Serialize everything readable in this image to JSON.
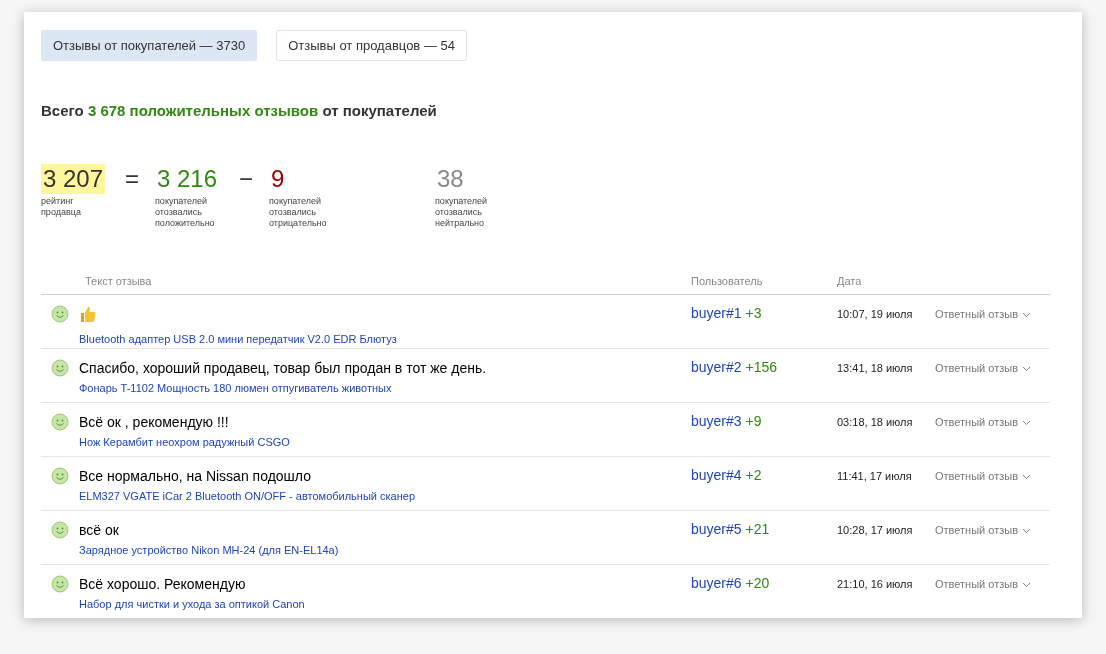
{
  "tabs": [
    {
      "label": "Отзывы от покупателей — 3730",
      "selected": true
    },
    {
      "label": "Отзывы от продавцов — 54",
      "selected": false
    }
  ],
  "summary": {
    "prefix": "Всего",
    "highlight": "3 678 положительных отзывов",
    "suffix": "от покупателей"
  },
  "stats": [
    {
      "kind": "rating",
      "value": "3 207",
      "caption": "рейтинг продавца"
    },
    {
      "kind": "operator",
      "value": "="
    },
    {
      "kind": "positive",
      "value": "3 216",
      "caption": "покупателей отозвались положительно"
    },
    {
      "kind": "operator",
      "value": "−"
    },
    {
      "kind": "negative",
      "value": "9",
      "caption": "покупателей отозвались отрицательно"
    },
    {
      "kind": "neutral",
      "value": "38",
      "caption": "покупателей отозвались нейтрально"
    }
  ],
  "table": {
    "columns": [
      "Текст отзыва",
      "Пользователь",
      "Дата"
    ],
    "rows": [
      {
        "kind": "thumbs_up",
        "product": "Bluetooth адаптер USB 2.0 мини передатчик V2.0 EDR Блютуз",
        "user": "buyer#1",
        "score": "+3",
        "date": "10:07, 19 июля",
        "reply": "Ответный отзыв"
      },
      {
        "kind": "text",
        "text": "Спасибо, хороший продавец, товар был продан в тот же день.",
        "product": "Фонарь T-1102 Мощность 180 люмен отпугиватель животных",
        "user": "buyer#2",
        "score": "+156",
        "date": "13:41, 18 июля",
        "reply": "Ответный отзыв"
      },
      {
        "kind": "text",
        "text": "Всё ок , рекомендую !!!",
        "product": "Нож Керамбит неохром радужный CSGO",
        "user": "buyer#3",
        "score": "+9",
        "date": "03:18, 18 июля",
        "reply": "Ответный отзыв"
      },
      {
        "kind": "text",
        "text": "Все нормально, на Nissan подошло",
        "product": "ELM327 VGATE iCar 2 Bluetooth ON/OFF - автомобильный сканер",
        "user": "buyer#4",
        "score": "+2",
        "date": "11:41, 17 июля",
        "reply": "Ответный отзыв"
      },
      {
        "kind": "text",
        "text": "всё ок",
        "product": "Зарядное устройство Nikon MH-24 (для EN-EL14a)",
        "user": "buyer#5",
        "score": "+21",
        "date": "10:28, 17 июля",
        "reply": "Ответный отзыв"
      },
      {
        "kind": "text",
        "text": "Всё хорошо. Рекомендую",
        "product": "Набор для чистки и ухода за оптикой Canon",
        "user": "buyer#6",
        "score": "+20",
        "date": "21:10, 16 июля",
        "reply": "Ответный отзыв"
      }
    ]
  }
}
